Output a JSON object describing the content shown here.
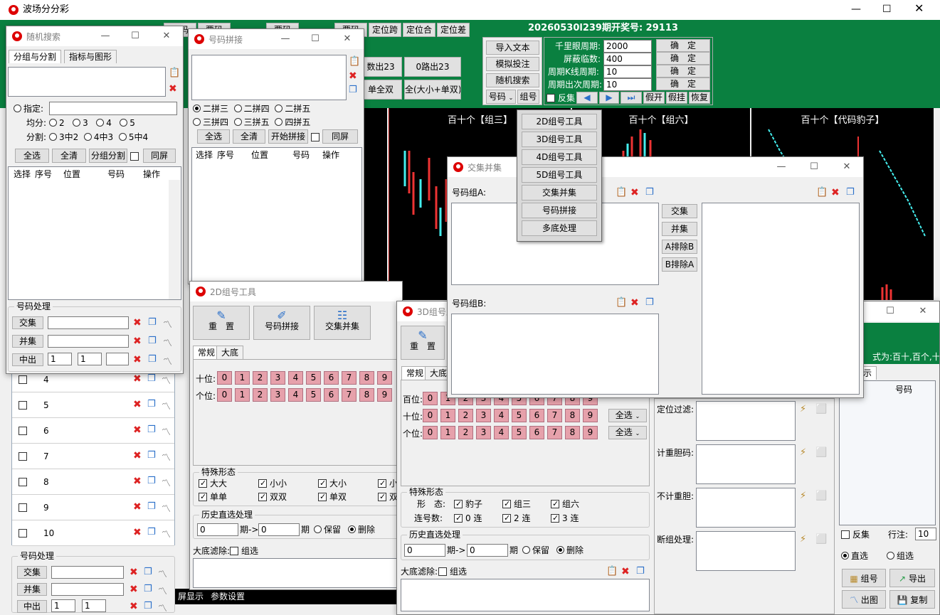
{
  "main": {
    "title": "波场分分彩",
    "draw_info": "20260530l239期开奖号: 29113",
    "top_buttons": [
      "不定位",
      "定位跨",
      "定位合",
      "定位差"
    ],
    "top_buttons_partial": [
      "票码",
      "票码",
      "票码",
      "票码"
    ],
    "mid_buttons": [
      "数出23",
      "0路出23",
      "单全双",
      "全(大小+单双)"
    ],
    "side_buttons": [
      "导入文本",
      "模拟投注",
      "随机搜索",
      "号码",
      "组号"
    ],
    "params": [
      {
        "label": "千里眼周期:",
        "value": "2000",
        "btn": "确　定"
      },
      {
        "label": "屏蔽临数:",
        "value": "400",
        "btn": "确　定"
      },
      {
        "label": "周期K线周期:",
        "value": "10",
        "btn": "确　定"
      },
      {
        "label": "周期出次周期:",
        "value": "10",
        "btn": "确　定"
      }
    ],
    "nav_row": {
      "reverse": "反集",
      "buttons": [
        "假开",
        "假挂",
        "恢复"
      ]
    },
    "charts": [
      {
        "title": "百十个【组三】"
      },
      {
        "title": "百十个【组六】"
      },
      {
        "title": "百十个【代码豹子】"
      }
    ],
    "status": {
      "left": "屏显示",
      "right": "参数设置"
    },
    "bg_rows": [
      "4",
      "5",
      "6",
      "7",
      "8",
      "9",
      "10"
    ],
    "bg_proc_title": "号码处理",
    "bg_proc": {
      "inter": "交集",
      "union": "并集",
      "out": "中出",
      "v1": "1",
      "v2": "1"
    }
  },
  "dropdown": [
    "2D组号工具",
    "3D组号工具",
    "4D组号工具",
    "5D组号工具",
    "交集并集",
    "号码拼接",
    "多底处理"
  ],
  "random_search": {
    "title": "随机搜索",
    "tabs": [
      "分组与分割",
      "指标与图形"
    ],
    "specify_label": "指定:",
    "even_label": "均分:",
    "even_opts": [
      "2",
      "3",
      "4",
      "5"
    ],
    "split_label": "分割:",
    "split_opts": [
      "3中2",
      "4中3",
      "5中4"
    ],
    "buttons": [
      "全选",
      "全清",
      "分组分割",
      "同屏"
    ],
    "columns": [
      "选择",
      "序号",
      "位置",
      "号码",
      "操作"
    ],
    "proc_title": "号码处理",
    "inter": "交集",
    "union": "并集",
    "out": "中出",
    "v1": "1",
    "v2": "1"
  },
  "concat": {
    "title": "号码拼接",
    "radios": [
      "二拼三",
      "二拼四",
      "二拼五",
      "三拼四",
      "三拼五",
      "四拼五"
    ],
    "buttons": [
      "全选",
      "全清",
      "开始拼接",
      "同屏"
    ],
    "columns": [
      "选择",
      "序号",
      "位置",
      "号码",
      "操作"
    ]
  },
  "tool2d": {
    "title": "2D组号工具",
    "toolbar": [
      "重　置",
      "号码拼接",
      "交集并集"
    ],
    "tabs": [
      "常规",
      "大底"
    ],
    "rows": [
      "十位:",
      "个位:"
    ],
    "digits": [
      "0",
      "1",
      "2",
      "3",
      "4",
      "5",
      "6",
      "7",
      "8",
      "9"
    ],
    "special_title": "特殊形态",
    "special": [
      "大大",
      "小小",
      "大小",
      "小",
      "单单",
      "双双",
      "单双",
      "双"
    ],
    "history_title": "历史直选处理",
    "hist_from": "0",
    "hist_to": "0",
    "period": "期->",
    "period2": "期",
    "keep": "保留",
    "del": "删除",
    "bigbase": "大底滤除:",
    "group": "组选"
  },
  "tool3d": {
    "title": "3D组号工具",
    "toolbar": [
      "重　置"
    ],
    "tabs": [
      "常规",
      "大底"
    ],
    "rows": [
      "百位:",
      "十位:",
      "个位:"
    ],
    "digits": [
      "0",
      "1",
      "2",
      "3",
      "4",
      "5",
      "6",
      "7",
      "8",
      "9"
    ],
    "allsel": "全选",
    "special_title": "特殊形态",
    "form_label": "形　态:",
    "forms": [
      "豹子",
      "组三",
      "组六"
    ],
    "link_label": "连号数:",
    "links": [
      "0 连",
      "2 连",
      "3 连"
    ],
    "history_title": "历史直选处理",
    "hist_from": "0",
    "hist_to": "0",
    "period": "期->",
    "period2": "期",
    "keep": "保留",
    "del": "删除",
    "bigbase": "大底滤除:",
    "group": "组选",
    "filters": [
      "定位过滤:",
      "计重胆码:",
      "不计重胆:",
      "断组处理:"
    ],
    "right_hint": "式为:百十,百个,十个",
    "right_tab": "示",
    "right_col": "号码",
    "reverse": "反集",
    "row_label": "行注:",
    "row_value": "10",
    "direct": "直选",
    "grp": "组选",
    "btns": [
      "组号",
      "导出",
      "出图",
      "复制"
    ]
  },
  "intersect": {
    "title": "交集并集",
    "groupA": "号码组A:",
    "groupB": "号码组B:",
    "ops": [
      "交集",
      "并集",
      "A排除B",
      "B排除A"
    ]
  }
}
